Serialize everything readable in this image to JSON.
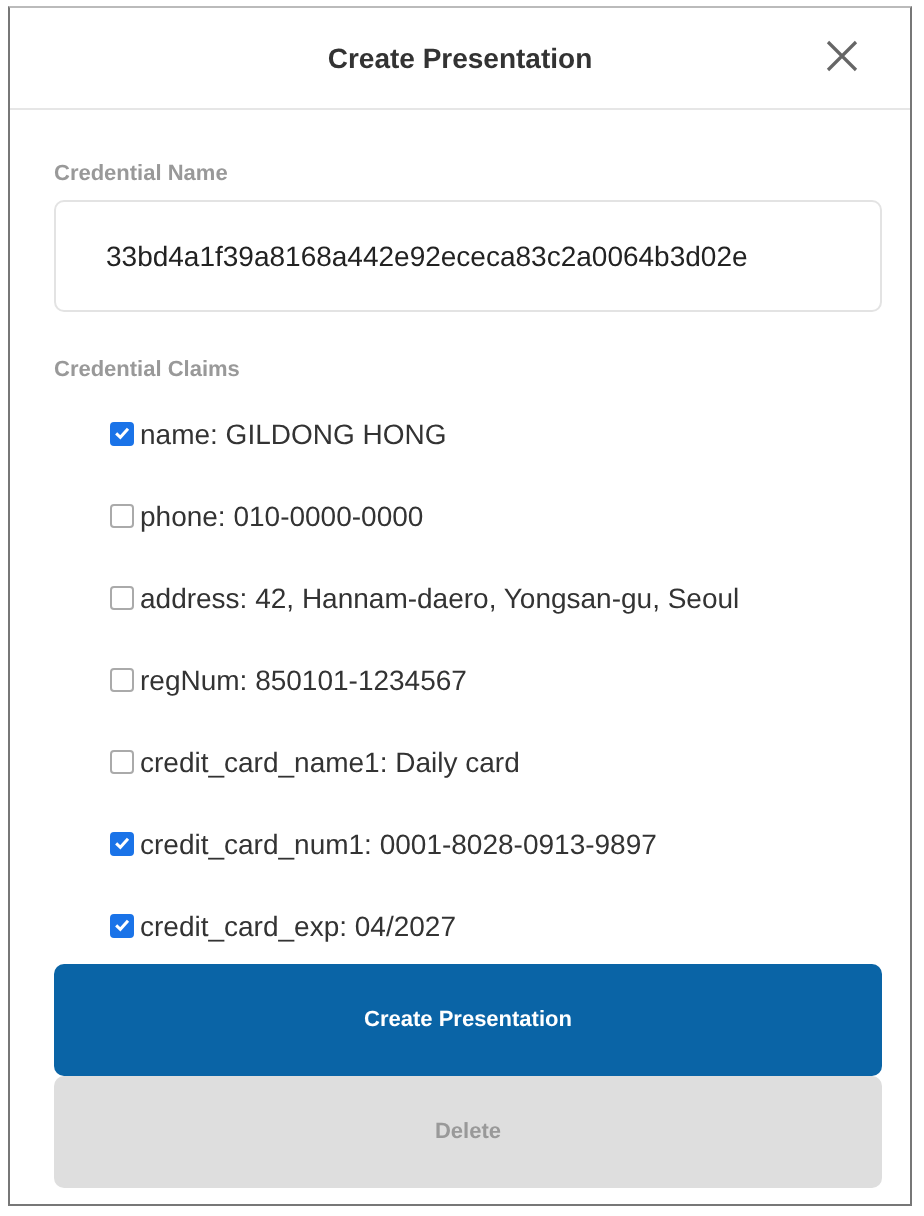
{
  "dialog": {
    "title": "Create Presentation"
  },
  "credential_name": {
    "label": "Credential Name",
    "value": "33bd4a1f39a8168a442e92ececa83c2a0064b3d02e"
  },
  "claims_label": "Credential Claims",
  "claims": [
    {
      "text": "name: GILDONG HONG",
      "checked": true
    },
    {
      "text": "phone: 010-0000-0000",
      "checked": false
    },
    {
      "text": "address: 42, Hannam-daero, Yongsan-gu, Seoul",
      "checked": false
    },
    {
      "text": "regNum: 850101-1234567",
      "checked": false
    },
    {
      "text": "credit_card_name1: Daily card",
      "checked": false
    },
    {
      "text": "credit_card_num1: 0001-8028-0913-9897",
      "checked": true
    },
    {
      "text": "credit_card_exp: 04/2027",
      "checked": true
    }
  ],
  "buttons": [
    {
      "label": "Create Presentation",
      "kind": "primary",
      "disabled": false
    },
    {
      "label": "Delete",
      "kind": "secondary",
      "disabled": true
    }
  ]
}
